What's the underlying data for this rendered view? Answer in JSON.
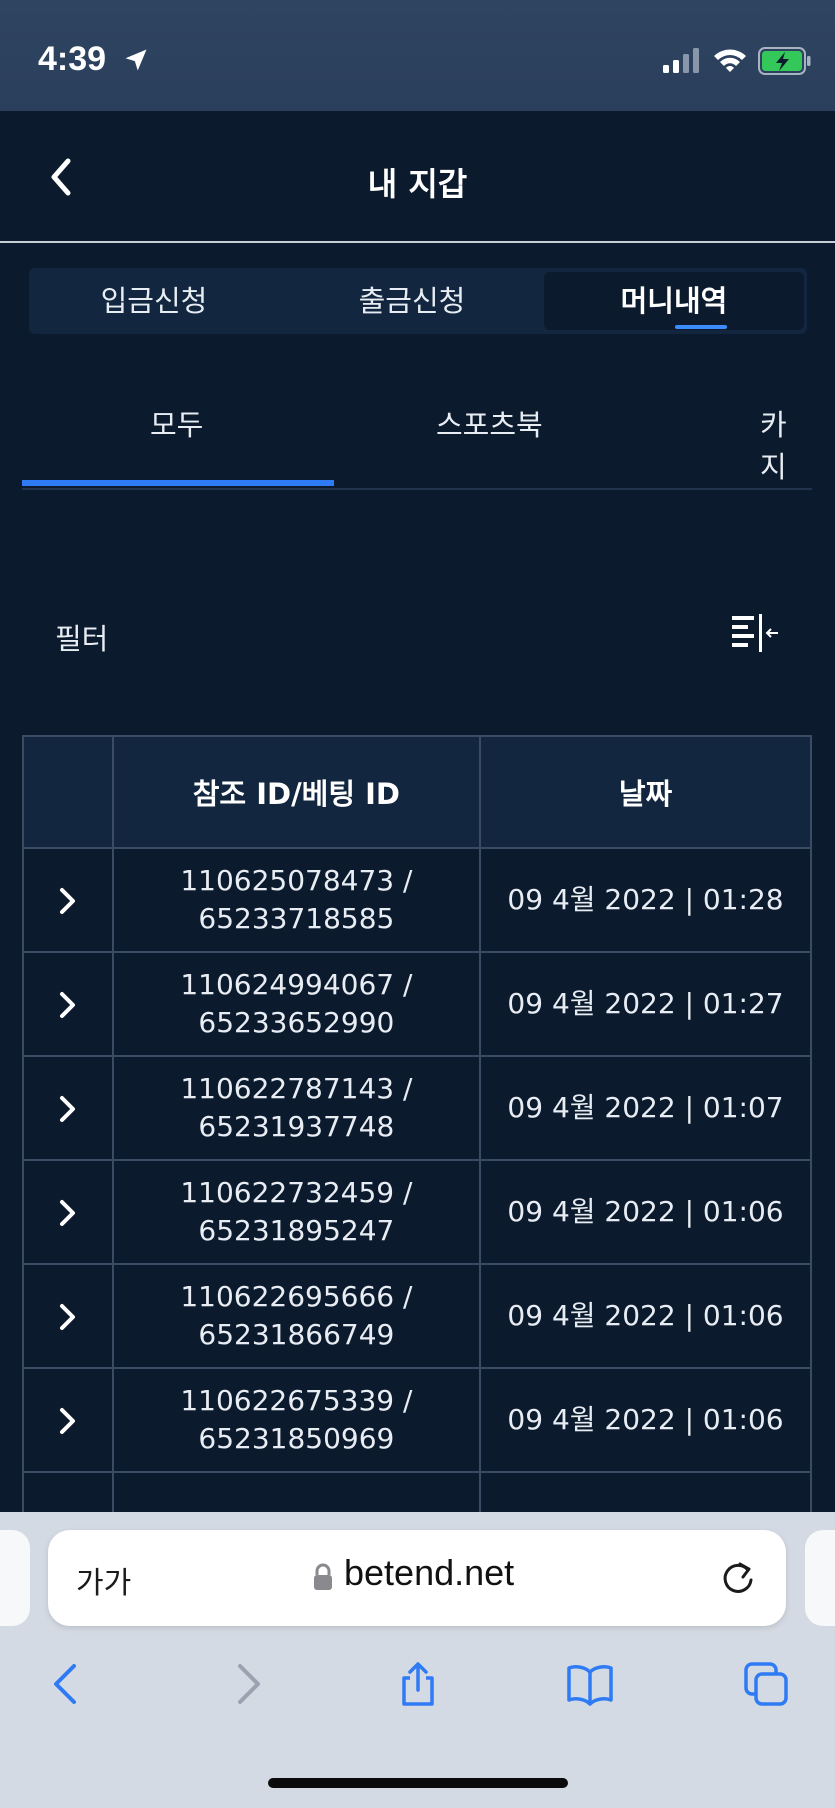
{
  "status_bar": {
    "time": "4:39"
  },
  "header": {
    "title": "내 지갑"
  },
  "segment_tabs": [
    {
      "label": "입금신청"
    },
    {
      "label": "출금신청"
    },
    {
      "label": "머니내역"
    }
  ],
  "sub_tabs": [
    {
      "label": "모두"
    },
    {
      "label": "스포츠북"
    },
    {
      "label": "카지"
    }
  ],
  "filter": {
    "label": "필터"
  },
  "table": {
    "headers": [
      "",
      "참조 ID/베팅 ID",
      "날짜"
    ],
    "rows": [
      {
        "ref_line1": "110625078473 /",
        "ref_line2": "65233718585",
        "date": "09 4월 2022 | 01:28"
      },
      {
        "ref_line1": "110624994067 /",
        "ref_line2": "65233652990",
        "date": "09 4월 2022 | 01:27"
      },
      {
        "ref_line1": "110622787143 /",
        "ref_line2": "65231937748",
        "date": "09 4월 2022 | 01:07"
      },
      {
        "ref_line1": "110622732459 /",
        "ref_line2": "65231895247",
        "date": "09 4월 2022 | 01:06"
      },
      {
        "ref_line1": "110622695666 /",
        "ref_line2": "65231866749",
        "date": "09 4월 2022 | 01:06"
      },
      {
        "ref_line1": "110622675339 /",
        "ref_line2": "65231850969",
        "date": "09 4월 2022 | 01:06"
      }
    ]
  },
  "browser": {
    "text_size": "가가",
    "url": "betend.net"
  },
  "colors": {
    "background": "#0c1a2e",
    "panel": "#12263f",
    "accent": "#2f7bf5",
    "browser_blue": "#2f7bf5"
  }
}
